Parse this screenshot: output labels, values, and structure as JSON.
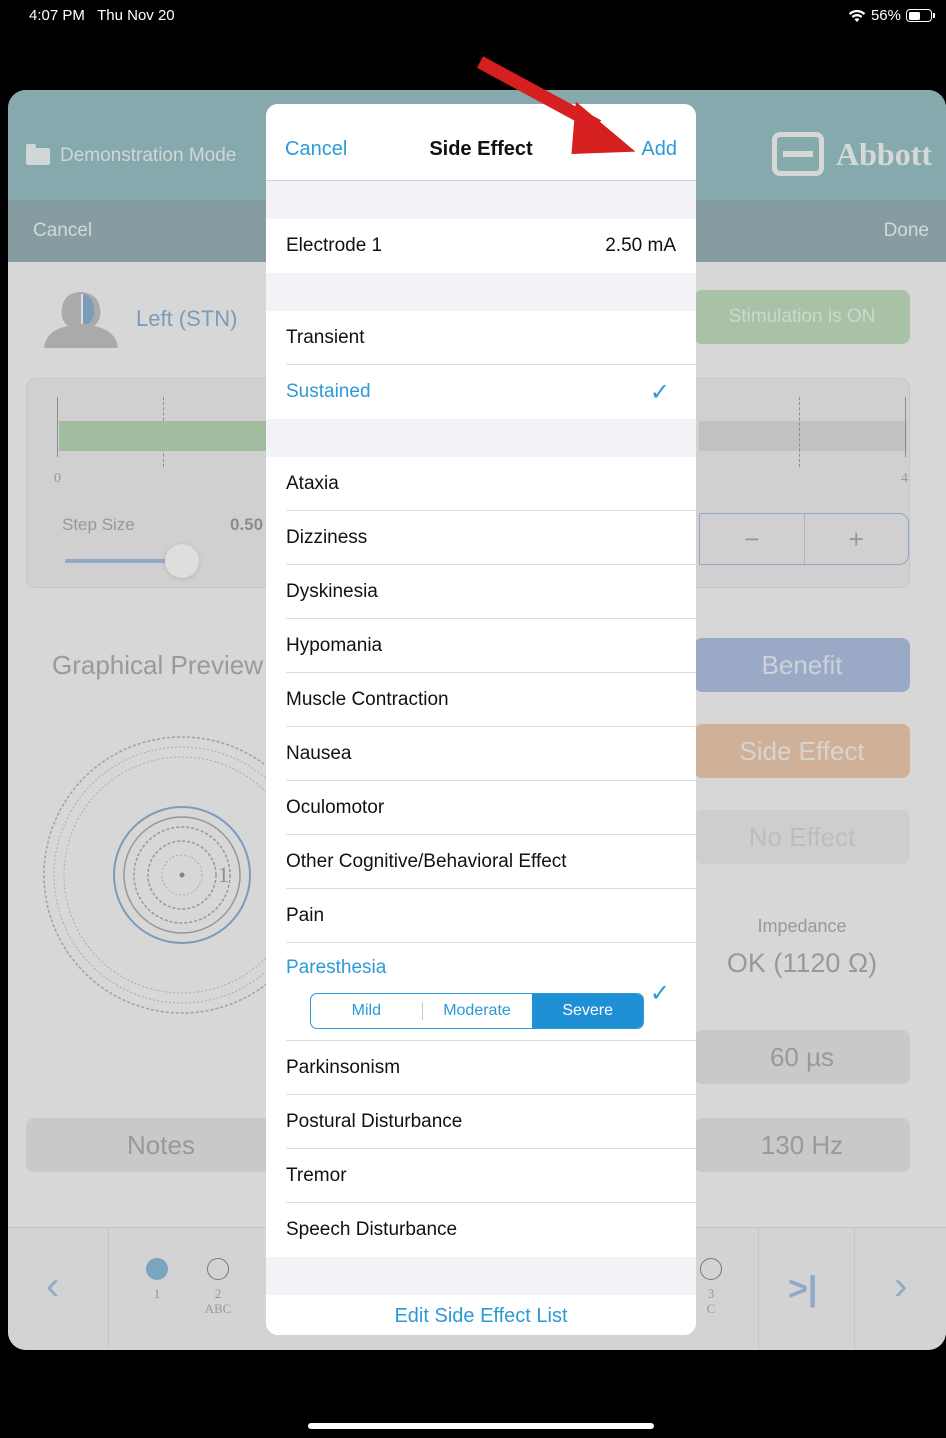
{
  "status": {
    "time": "4:07 PM",
    "date": "Thu Nov 20",
    "battery": "56%"
  },
  "app": {
    "mode_label": "Demonstration Mode",
    "brand": "Abbott",
    "cancel": "Cancel",
    "done": "Done",
    "lead_label": "Left (STN)",
    "stim_status": "Stimulation is ON",
    "scale_min": "0",
    "scale_max": "4",
    "step_size_label": "Step Size",
    "step_size_value": "0.50",
    "stepper_minus": "−",
    "stepper_plus": "+",
    "graph_title": "Graphical Preview",
    "ring_label": "1",
    "benefit": "Benefit",
    "side_effect": "Side Effect",
    "no_effect": "No Effect",
    "impedance_label": "Impedance",
    "impedance_value": "OK (1120 Ω)",
    "pulse_width": "60 µs",
    "rate": "130 Hz",
    "notes": "Notes",
    "footer": {
      "prev": "‹",
      "next": "›",
      "skip_end": ">|",
      "contacts": [
        {
          "num": "1",
          "sub": ""
        },
        {
          "num": "2",
          "sub": "ABC"
        },
        {
          "num": "3",
          "sub": "C"
        }
      ]
    }
  },
  "sheet": {
    "nav": {
      "cancel": "Cancel",
      "title": "Side Effect",
      "add": "Add"
    },
    "electrode": {
      "label": "Electrode 1",
      "value": "2.50 mA"
    },
    "duration": [
      {
        "label": "Transient",
        "selected": false
      },
      {
        "label": "Sustained",
        "selected": true
      }
    ],
    "effects": [
      "Ataxia",
      "Dizziness",
      "Dyskinesia",
      "Hypomania",
      "Muscle Contraction",
      "Nausea",
      "Oculomotor",
      "Other Cognitive/Behavioral Effect",
      "Pain"
    ],
    "selected_effect": {
      "label": "Paresthesia",
      "severity_options": [
        "Mild",
        "Moderate",
        "Severe"
      ],
      "selected_severity": "Severe"
    },
    "effects_after": [
      "Parkinsonism",
      "Postural Disturbance",
      "Tremor",
      "Speech Disturbance"
    ],
    "footer_link": "Edit Side Effect List"
  },
  "colors": {
    "accent_blue": "#2b9ad9",
    "annotation_arrow": "#d61f1f",
    "header_teal": "#6aa6ae"
  },
  "icons": [
    "wifi-icon",
    "battery-icon",
    "folder-icon",
    "abbott-logo-icon",
    "head-icon",
    "checkmark-icon",
    "annotation-arrow-icon"
  ]
}
